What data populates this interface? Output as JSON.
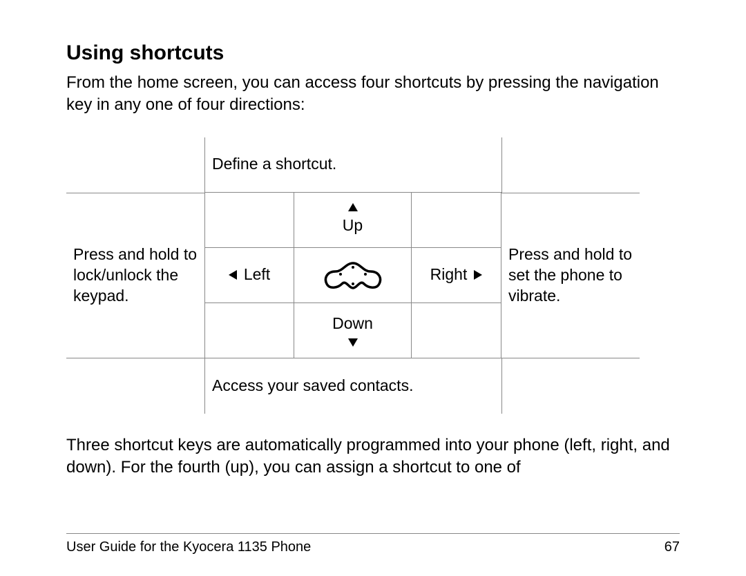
{
  "heading": "Using shortcuts",
  "intro": "From the home screen, you can access four shortcuts by pressing the navigation key in any one of four directions:",
  "diagram": {
    "top": "Define a shortcut.",
    "up": "Up",
    "left_note": "Press and hold to lock/unlock the keypad.",
    "left": "Left",
    "right": "Right",
    "right_note": "Press and hold to set the phone to vibrate.",
    "down": "Down",
    "bottom": "Access your saved contacts."
  },
  "after": "Three shortcut keys are automatically programmed into your phone (left, right, and down). For the fourth (up), you can assign a shortcut to one of",
  "footer": {
    "title": "User Guide for the Kyocera 1135 Phone",
    "page": "67"
  }
}
